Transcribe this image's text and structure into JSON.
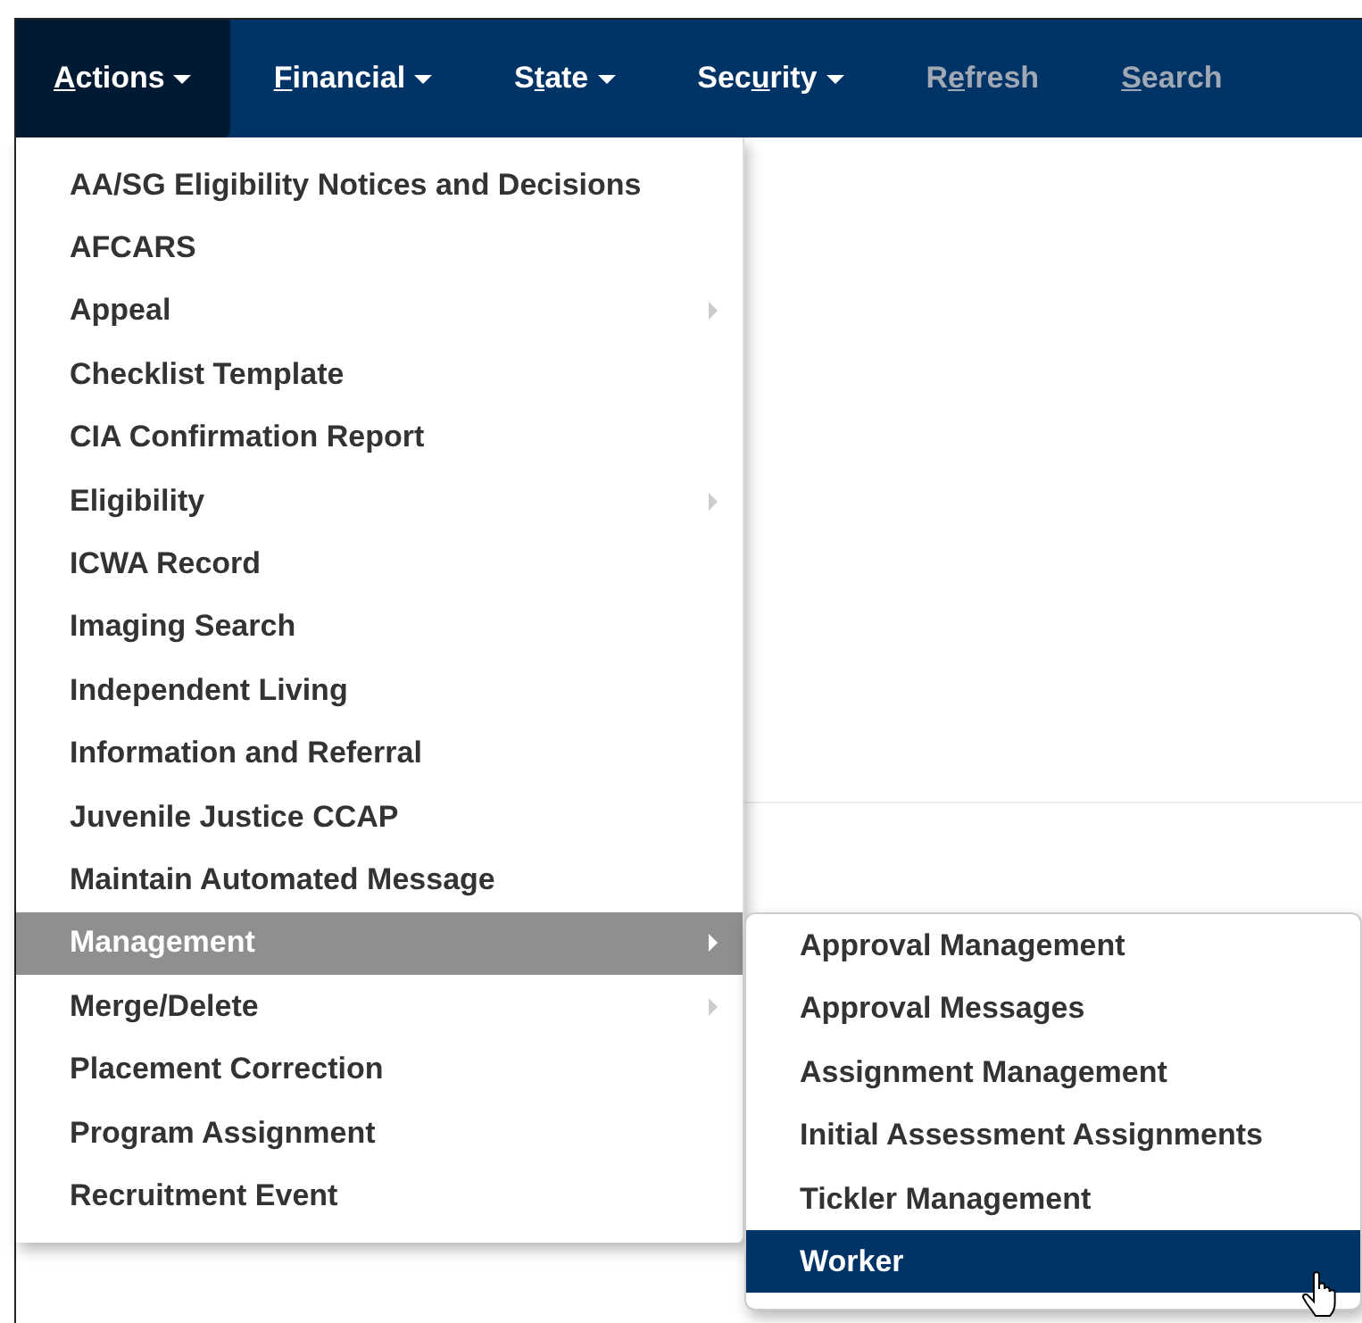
{
  "nav": [
    {
      "key": "A",
      "post": "ctions",
      "has_dropdown": true,
      "active": true,
      "disabled": false
    },
    {
      "key": "F",
      "post": "inancial",
      "has_dropdown": true,
      "active": false,
      "disabled": false
    },
    {
      "pre": "S",
      "key": "t",
      "post": "ate",
      "has_dropdown": true,
      "active": false,
      "disabled": false
    },
    {
      "pre": "Sec",
      "key": "u",
      "post": "rity",
      "has_dropdown": true,
      "active": false,
      "disabled": false
    },
    {
      "pre": "R",
      "key": "e",
      "post": "fresh",
      "has_dropdown": false,
      "active": false,
      "disabled": true
    },
    {
      "key": "S",
      "post": "earch",
      "has_dropdown": false,
      "active": false,
      "disabled": true
    }
  ],
  "menu": {
    "items": [
      {
        "label": "AA/SG Eligibility Notices and Decisions",
        "has_submenu": false,
        "selected": false
      },
      {
        "label": "AFCARS",
        "has_submenu": false,
        "selected": false
      },
      {
        "label": "Appeal",
        "has_submenu": true,
        "selected": false
      },
      {
        "label": "Checklist Template",
        "has_submenu": false,
        "selected": false
      },
      {
        "label": "CIA Confirmation Report",
        "has_submenu": false,
        "selected": false
      },
      {
        "label": "Eligibility",
        "has_submenu": true,
        "selected": false
      },
      {
        "label": "ICWA Record",
        "has_submenu": false,
        "selected": false
      },
      {
        "label": "Imaging Search",
        "has_submenu": false,
        "selected": false
      },
      {
        "label": "Independent Living",
        "has_submenu": false,
        "selected": false
      },
      {
        "label": "Information and Referral",
        "has_submenu": false,
        "selected": false
      },
      {
        "label": "Juvenile Justice CCAP",
        "has_submenu": false,
        "selected": false
      },
      {
        "label": "Maintain Automated Message",
        "has_submenu": false,
        "selected": false
      },
      {
        "label": "Management",
        "has_submenu": true,
        "selected": true
      },
      {
        "label": "Merge/Delete",
        "has_submenu": true,
        "selected": false
      },
      {
        "label": "Placement Correction",
        "has_submenu": false,
        "selected": false
      },
      {
        "label": "Program Assignment",
        "has_submenu": false,
        "selected": false
      },
      {
        "label": "Recruitment Event",
        "has_submenu": false,
        "selected": false
      }
    ]
  },
  "submenu": {
    "items": [
      {
        "label": "Approval Management",
        "selected": false
      },
      {
        "label": "Approval Messages",
        "selected": false
      },
      {
        "label": "Assignment Management",
        "selected": false
      },
      {
        "label": "Initial Assessment Assignments",
        "selected": false
      },
      {
        "label": "Tickler Management",
        "selected": false
      },
      {
        "label": "Worker",
        "selected": true
      }
    ]
  }
}
